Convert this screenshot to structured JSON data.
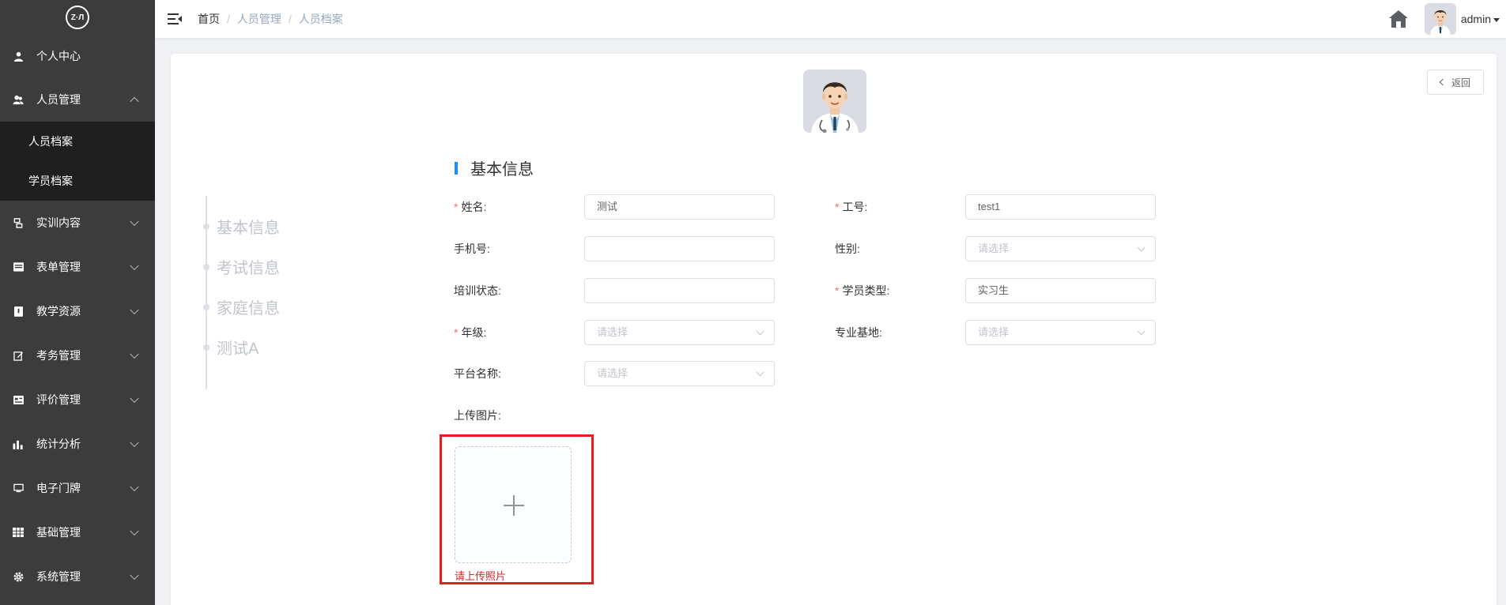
{
  "sidebar": {
    "logo_text": "Z·Л",
    "items": [
      {
        "label": "个人中心",
        "icon": "user-icon"
      },
      {
        "label": "人员管理",
        "icon": "users-icon",
        "expanded": true,
        "children": [
          "人员档案",
          "学员档案"
        ]
      },
      {
        "label": "实训内容",
        "icon": "training-icon"
      },
      {
        "label": "表单管理",
        "icon": "form-icon"
      },
      {
        "label": "教学资源",
        "icon": "book-icon"
      },
      {
        "label": "考务管理",
        "icon": "edit-icon"
      },
      {
        "label": "评价管理",
        "icon": "evaluation-icon"
      },
      {
        "label": "统计分析",
        "icon": "bar-chart-icon"
      },
      {
        "label": "电子门牌",
        "icon": "monitor-icon"
      },
      {
        "label": "基础管理",
        "icon": "grid-icon"
      },
      {
        "label": "系统管理",
        "icon": "gear-icon"
      }
    ]
  },
  "header": {
    "breadcrumb": [
      "首页",
      "人员管理",
      "人员档案"
    ],
    "username": "admin"
  },
  "page": {
    "back_label": "返回",
    "anchors": [
      "基本信息",
      "考试信息",
      "家庭信息",
      "测试A"
    ],
    "section_title": "基本信息",
    "fields": {
      "name": {
        "label": "姓名:",
        "value": "测试",
        "required": true
      },
      "job_no": {
        "label": "工号:",
        "value": "test1",
        "required": true
      },
      "phone": {
        "label": "手机号:",
        "value": ""
      },
      "gender": {
        "label": "性别:",
        "placeholder": "请选择"
      },
      "training_status": {
        "label": "培训状态:",
        "value": ""
      },
      "student_type": {
        "label": "学员类型:",
        "value": "实习生",
        "required": true
      },
      "grade": {
        "label": "年级:",
        "placeholder": "请选择",
        "required": true
      },
      "base": {
        "label": "专业基地:",
        "placeholder": "请选择"
      },
      "platform": {
        "label": "平台名称:",
        "placeholder": "请选择"
      },
      "upload": {
        "label": "上传图片:",
        "error": "请上传照片"
      }
    }
  },
  "colors": {
    "sidebar_bg": "#3c3c3c",
    "submenu_bg": "#1f1f1f",
    "accent": "#1890ff",
    "error": "#e02020"
  }
}
